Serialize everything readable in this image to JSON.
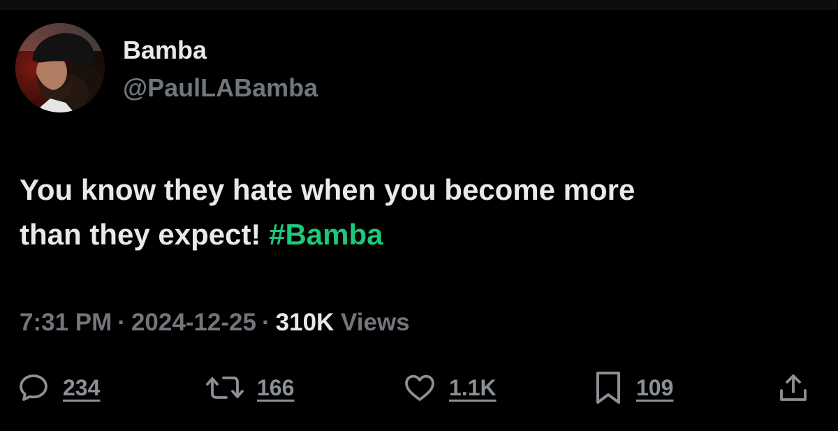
{
  "tweet": {
    "author": {
      "display_name": "Bamba",
      "handle": "@PaulLABamba"
    },
    "text_line1": "You know they hate when you become more",
    "text_line2": "than they expect!",
    "hashtag": "#Bamba",
    "time": "7:31 PM",
    "date": "2024-12-25",
    "separator": "·",
    "views_count": "310K",
    "views_label": "Views"
  },
  "actions": {
    "replies": "234",
    "reposts": "166",
    "likes": "1.1K",
    "bookmarks": "109",
    "icons": {
      "reply": "speech-bubble-icon",
      "repost": "repost-arrows-icon",
      "like": "heart-icon",
      "bookmark": "bookmark-icon",
      "share": "share-upload-icon"
    }
  },
  "colors": {
    "background": "#000000",
    "primary_text": "#e7e9ea",
    "secondary_text": "#71767b",
    "hashtag": "#1ec87a",
    "icon": "#8b9096"
  }
}
